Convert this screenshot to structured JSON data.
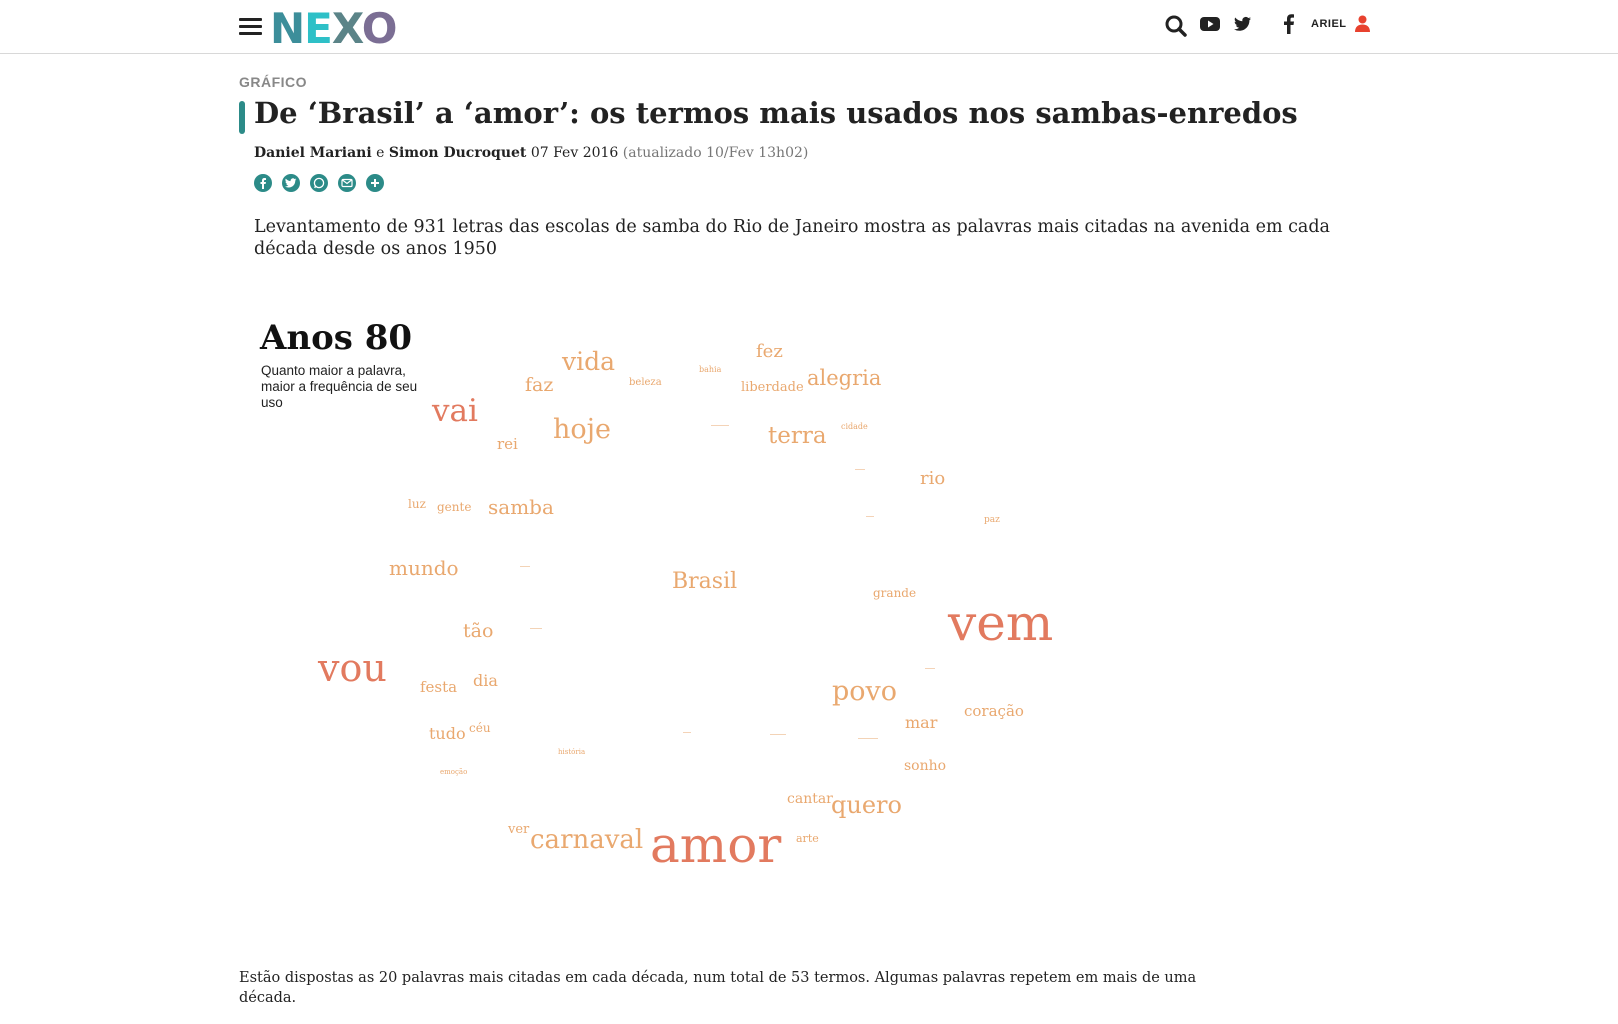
{
  "header": {
    "logo_text": "NEXO",
    "user_label": "ARIEL",
    "icons": [
      "menu-icon",
      "search-icon",
      "youtube-icon",
      "twitter-icon",
      "facebook-icon",
      "user-icon"
    ]
  },
  "article": {
    "kicker": "GRÁFICO",
    "title": "De ‘Brasil’ a ‘amor’: os termos mais usados nos sambas-enredos",
    "author1": "Daniel Mariani",
    "author_sep": "e",
    "author2": "Simon Ducroquet",
    "date": "07 Fev 2016",
    "updated": "(atualizado 10/Fev 13h02)",
    "share_icons": [
      "facebook-share-icon",
      "twitter-share-icon",
      "whatsapp-share-icon",
      "email-share-icon",
      "more-share-icon"
    ],
    "lede": "Levantamento de 931 letras das escolas de samba do Rio de Janeiro mostra as palavras mais citadas na avenida em cada década desde os anos 1950",
    "footnote": "Estão dispostas as 20 palavras mais citadas em cada década, num total de 53 termos. Algumas palavras repetem em mais de uma década."
  },
  "colors": {
    "accent": "#2c8b88",
    "word_light": "#e9a86f",
    "word_strong": "#e27a5f"
  },
  "chart_data": {
    "type": "wordcloud",
    "title": "Anos 80",
    "subtitle": "Quanto maior a palavra, maior a frequência de seu uso",
    "words": [
      {
        "text": "vem",
        "size": 50
      },
      {
        "text": "amor",
        "size": 50
      },
      {
        "text": "vou",
        "size": 38
      },
      {
        "text": "vai",
        "size": 31
      },
      {
        "text": "povo",
        "size": 27
      },
      {
        "text": "hoje",
        "size": 27
      },
      {
        "text": "carnaval",
        "size": 26
      },
      {
        "text": "vida",
        "size": 25
      },
      {
        "text": "quero",
        "size": 24
      },
      {
        "text": "terra",
        "size": 23
      },
      {
        "text": "Brasil",
        "size": 22
      },
      {
        "text": "alegria",
        "size": 21
      },
      {
        "text": "samba",
        "size": 20
      },
      {
        "text": "mundo",
        "size": 20
      },
      {
        "text": "faz",
        "size": 19
      },
      {
        "text": "tão",
        "size": 19
      },
      {
        "text": "fez",
        "size": 18
      },
      {
        "text": "rio",
        "size": 18
      },
      {
        "text": "mar",
        "size": 16
      },
      {
        "text": "dia",
        "size": 16
      },
      {
        "text": "tudo",
        "size": 16
      },
      {
        "text": "rei",
        "size": 15
      },
      {
        "text": "coração",
        "size": 15
      },
      {
        "text": "festa",
        "size": 15
      },
      {
        "text": "sonho",
        "size": 14
      },
      {
        "text": "cantar",
        "size": 14
      },
      {
        "text": "liberdade",
        "size": 13
      },
      {
        "text": "ver",
        "size": 13
      },
      {
        "text": "luz",
        "size": 12
      },
      {
        "text": "céu",
        "size": 12
      },
      {
        "text": "grande",
        "size": 12
      },
      {
        "text": "gente",
        "size": 12
      },
      {
        "text": "arte",
        "size": 11
      },
      {
        "text": "beleza",
        "size": 10
      },
      {
        "text": "paz",
        "size": 9
      },
      {
        "text": "cidade",
        "size": 8
      },
      {
        "text": "bahia",
        "size": 8
      },
      {
        "text": "história",
        "size": 7
      },
      {
        "text": "emoção",
        "size": 7
      }
    ]
  }
}
